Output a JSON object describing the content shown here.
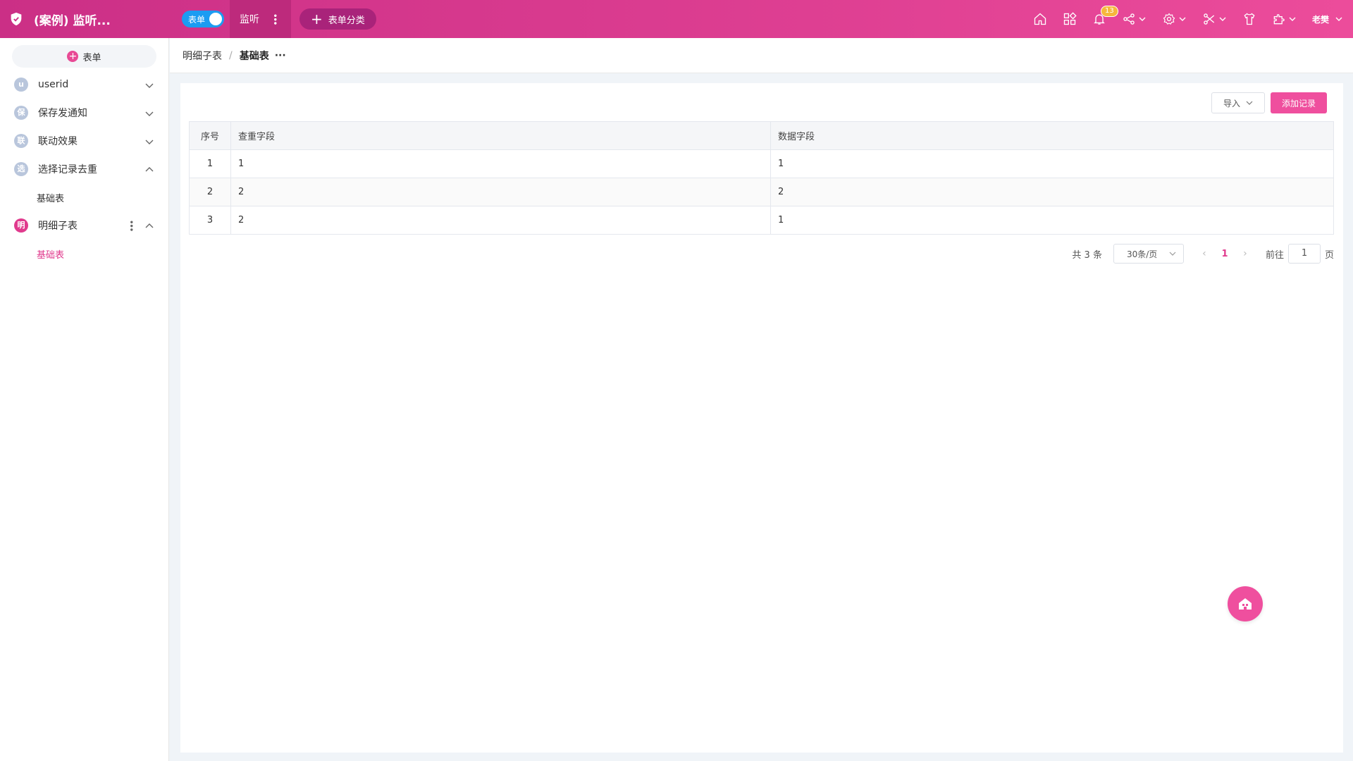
{
  "header": {
    "app_title": "(案例) 监听...",
    "toggle_label": "表单",
    "active_tab": "监听",
    "add_category": "表单分类",
    "notification_count": "13",
    "user_name": "老樊",
    "icons": [
      "shield-icon",
      "home-icon",
      "apps-icon",
      "bell-icon",
      "share-icon",
      "gear-icon",
      "tools-icon",
      "shirt-icon",
      "puzzle-icon"
    ]
  },
  "sidebar": {
    "add_form_label": "表单",
    "items": [
      {
        "badge": "u",
        "label": "userid",
        "expanded": false
      },
      {
        "badge": "保",
        "label": "保存发通知",
        "expanded": false
      },
      {
        "badge": "联",
        "label": "联动效果",
        "expanded": false
      },
      {
        "badge": "选",
        "label": "选择记录去重",
        "expanded": true,
        "children": [
          "基础表"
        ]
      },
      {
        "badge": "明",
        "label": "明细子表",
        "expanded": true,
        "active": true,
        "children": [
          "基础表"
        ]
      }
    ]
  },
  "breadcrumb": {
    "parent": "明细子表",
    "separator": "/",
    "current": "基础表",
    "more": "···"
  },
  "toolbar": {
    "import_label": "导入",
    "add_record_label": "添加记录"
  },
  "table": {
    "columns": [
      "序号",
      "查重字段",
      "数据字段"
    ],
    "rows": [
      [
        "1",
        "1",
        "1"
      ],
      [
        "2",
        "2",
        "2"
      ],
      [
        "3",
        "2",
        "1"
      ]
    ]
  },
  "pagination": {
    "total": "共 3 条",
    "page_size": "30条/页",
    "current_page": "1",
    "goto_label": "前往",
    "goto_value": "1",
    "page_suffix": "页"
  },
  "colors": {
    "brand": "#de3f92",
    "accent": "#ef4f9e",
    "toggle": "#1b9cf2"
  }
}
